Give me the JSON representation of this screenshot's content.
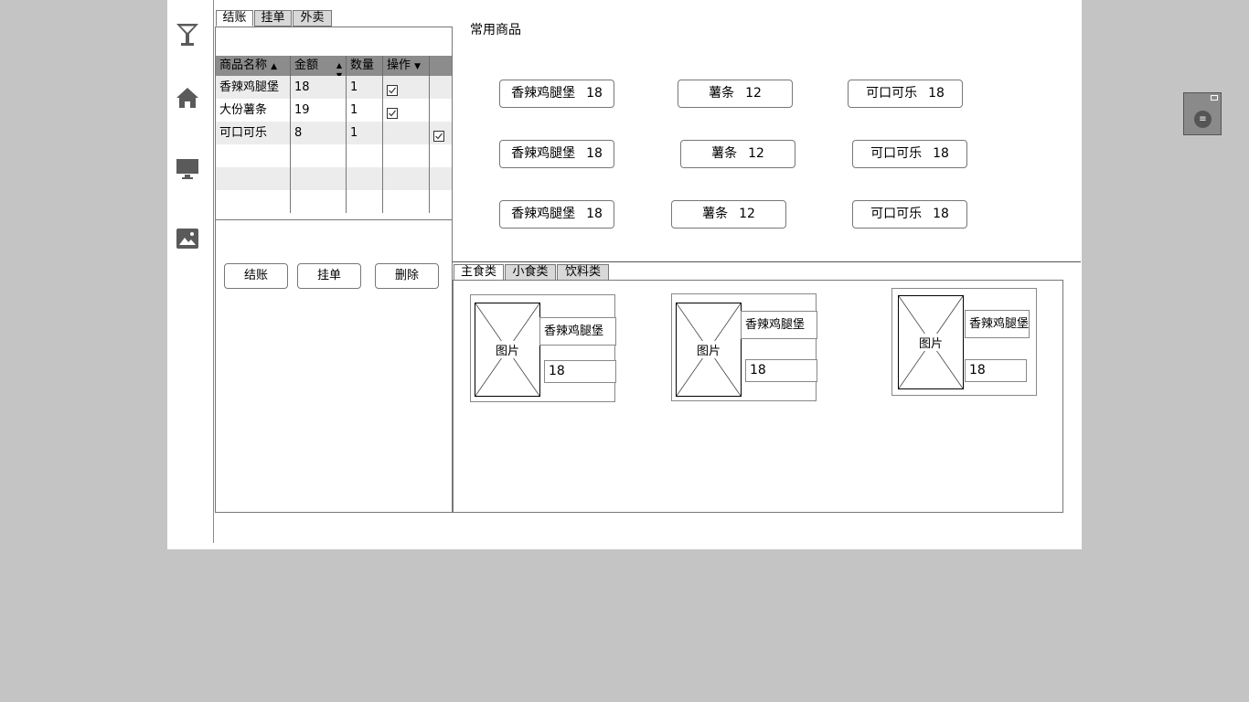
{
  "sidebar": {
    "icons": [
      "cocktail-icon",
      "home-icon",
      "monitor-icon",
      "image-icon"
    ]
  },
  "order_tabs": [
    {
      "label": "结账",
      "active": true
    },
    {
      "label": "挂单",
      "active": false
    },
    {
      "label": "外卖",
      "active": false
    }
  ],
  "order_grid": {
    "columns": [
      "商品名称",
      "金额",
      "数量",
      "操作"
    ],
    "rows": [
      {
        "name": "香辣鸡腿堡",
        "amount": "18",
        "qty": "1",
        "op_checked": true,
        "extra_checked": false
      },
      {
        "name": "大份薯条",
        "amount": "19",
        "qty": "1",
        "op_checked": true,
        "extra_checked": false
      },
      {
        "name": "可口可乐",
        "amount": "8",
        "qty": "1",
        "op_checked": false,
        "extra_checked": true
      }
    ]
  },
  "order_buttons": {
    "checkout": "结账",
    "hold": "挂单",
    "delete": "删除"
  },
  "common_products": {
    "title": "常用商品",
    "rows": [
      [
        {
          "name": "香辣鸡腿堡",
          "price": "18"
        },
        {
          "name": "薯条",
          "price": "12"
        },
        {
          "name": "可口可乐",
          "price": "18"
        }
      ],
      [
        {
          "name": "香辣鸡腿堡",
          "price": "18"
        },
        {
          "name": "薯条",
          "price": "12"
        },
        {
          "name": "可口可乐",
          "price": "18"
        }
      ],
      [
        {
          "name": "香辣鸡腿堡",
          "price": "18"
        },
        {
          "name": "薯条",
          "price": "12"
        },
        {
          "name": "可口可乐",
          "price": "18"
        }
      ]
    ]
  },
  "category_tabs": [
    {
      "label": "主食类",
      "active": true
    },
    {
      "label": "小食类",
      "active": false
    },
    {
      "label": "饮料类",
      "active": false
    }
  ],
  "menu_cards": [
    {
      "image_label": "图片",
      "name": "香辣鸡腿堡",
      "price": "18"
    },
    {
      "image_label": "图片",
      "name": "香辣鸡腿堡",
      "price": "18"
    },
    {
      "image_label": "图片",
      "name": "香辣鸡腿堡",
      "price": "18"
    }
  ],
  "colors": {
    "canvas": "#ffffff",
    "backdrop": "#c4c4c4",
    "grid_header": "#8c8c8c",
    "icon": "#5a5a5a"
  }
}
